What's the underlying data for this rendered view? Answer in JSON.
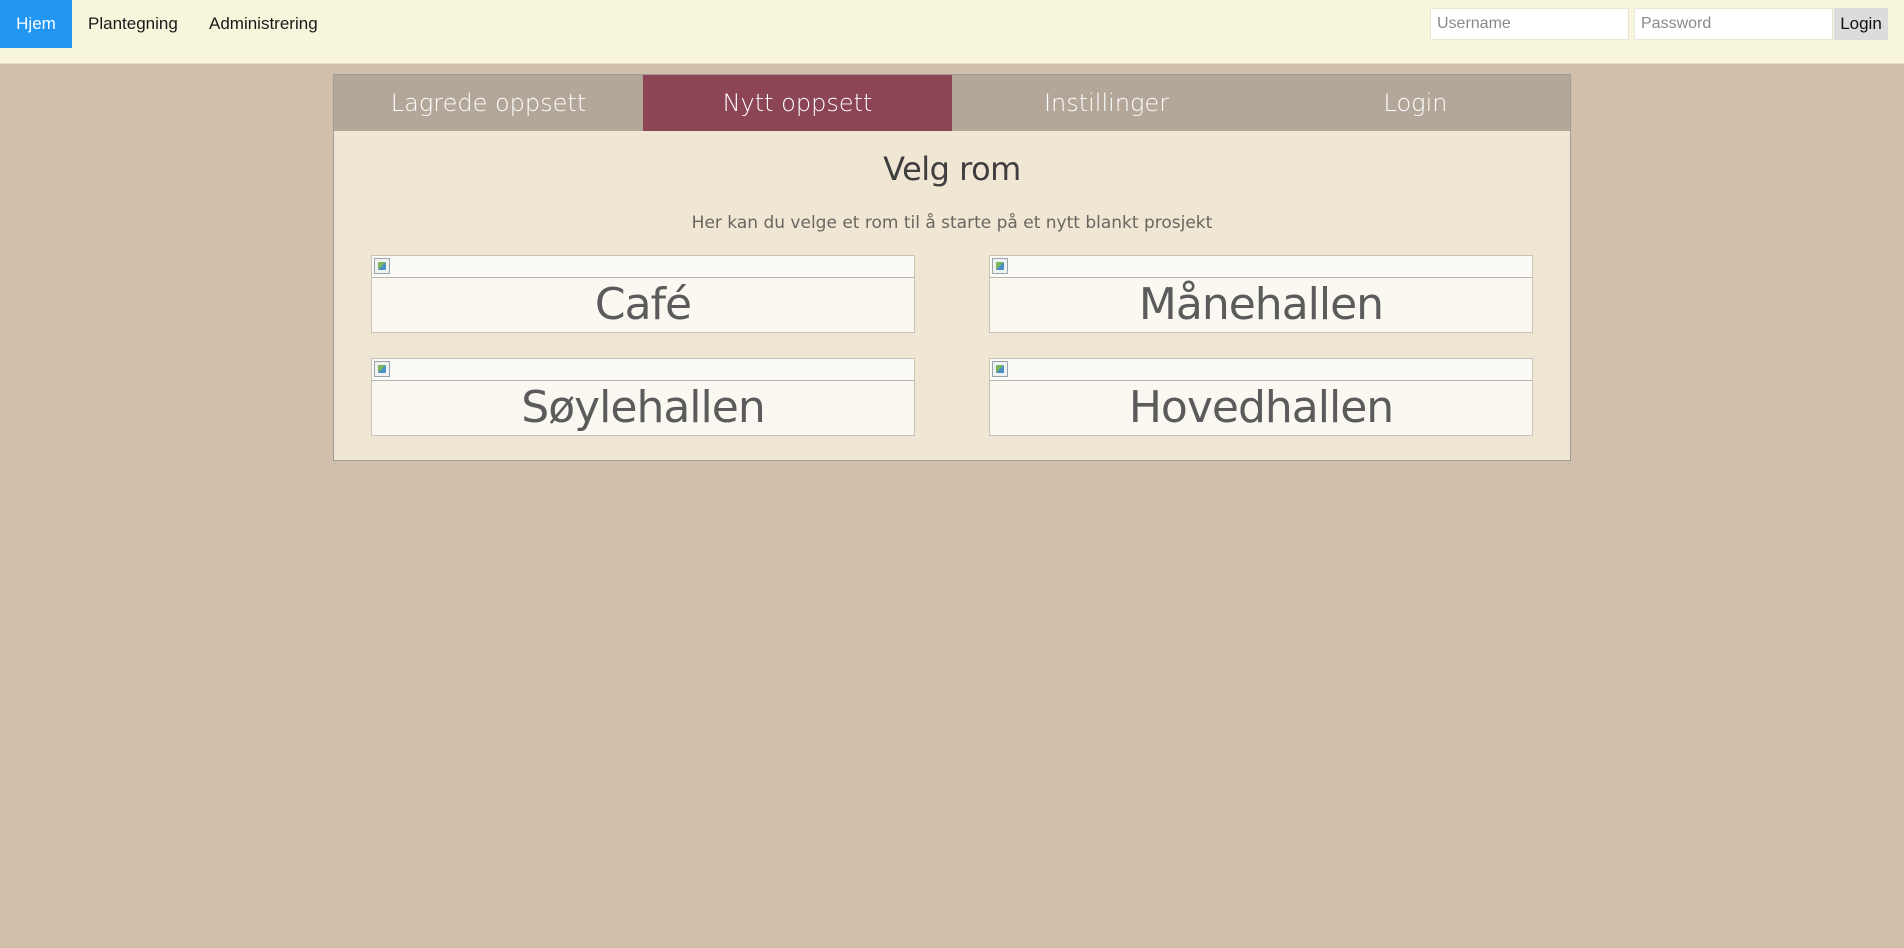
{
  "topnav": {
    "items": [
      "Hjem",
      "Plantegning",
      "Administrering"
    ],
    "username_placeholder": "Username",
    "password_placeholder": "Password",
    "login_label": "Login"
  },
  "tabs": [
    "Lagrede oppsett",
    "Nytt oppsett",
    "Instillinger",
    "Login"
  ],
  "active_tab": "Nytt oppsett",
  "content": {
    "heading": "Velg rom",
    "subtext": "Her kan du velge et rom til å starte på et nytt blankt prosjekt"
  },
  "rooms": [
    "Café",
    "Månehallen",
    "Søylehallen",
    "Hovedhallen"
  ],
  "icons": {
    "room_image": "broken-image-icon"
  },
  "colors": {
    "background": "#d1bfab",
    "topbar": "#f7f5dc",
    "nav_active": "#2196f3",
    "tab_bar": "#b2a799",
    "tab_active": "#8b4555",
    "panel": "#f0e6d4"
  }
}
